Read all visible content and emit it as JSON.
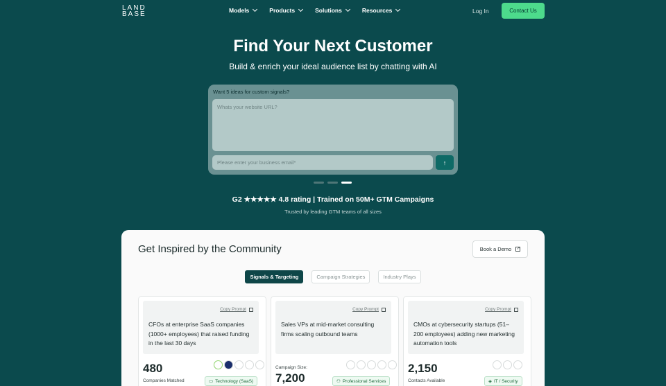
{
  "nav": {
    "logo_line1": "LAND",
    "logo_line2": "BASE",
    "links": [
      "Models",
      "Products",
      "Solutions",
      "Resources"
    ],
    "login": "Log In",
    "contact": "Contact Us"
  },
  "hero": {
    "title": "Find Your Next Customer",
    "subtitle": "Build & enrich your ideal audience list by chatting with AI"
  },
  "chat": {
    "question": "Want 5 ideas for custom signals?",
    "url_placeholder": "Whats your website URL?",
    "email_placeholder": "Please enter your business email*",
    "send_icon": "↑"
  },
  "carousel": {
    "count": 3,
    "active_index": 2
  },
  "rating": {
    "text": "G2 ★★★★★  4.8 rating | Trained on 50M+ GTM Campaigns",
    "trusted": "Trusted by leading GTM teams of all sizes"
  },
  "community": {
    "title": "Get Inspired by the Community",
    "demo_button": "Book a Demo",
    "tabs": [
      "Signals & Targeting",
      "Campaign Strategies",
      "Industry Plays"
    ],
    "active_tab": 0,
    "copy_label": "Copy Prompt",
    "cards": [
      {
        "prompt": "CFOs at enterprise SaaS companies (1000+ employees) that raised funding in the last 30 days",
        "stat_top": "",
        "stat": "480",
        "stat_label": "Companies Matched",
        "tag": "Technology (SaaS)",
        "tag_icon": "monitor-icon"
      },
      {
        "prompt": "Sales VPs at mid-market consulting firms scaling outbound teams",
        "stat_top": "Campaign Size:",
        "stat": "7,200",
        "stat_label": "",
        "tag": "Professional Services",
        "tag_icon": "people-icon"
      },
      {
        "prompt": "CMOs at cybersecurity startups (51–200 employees) adding new marketing automation tools",
        "stat_top": "",
        "stat": "2,150",
        "stat_label": "Contacts Available",
        "tag": "IT / Security",
        "tag_icon": "shield-icon"
      }
    ]
  },
  "colors": {
    "background": "#0b4a4d",
    "accent": "#4ddb8c",
    "active_tab": "#0e4648"
  }
}
